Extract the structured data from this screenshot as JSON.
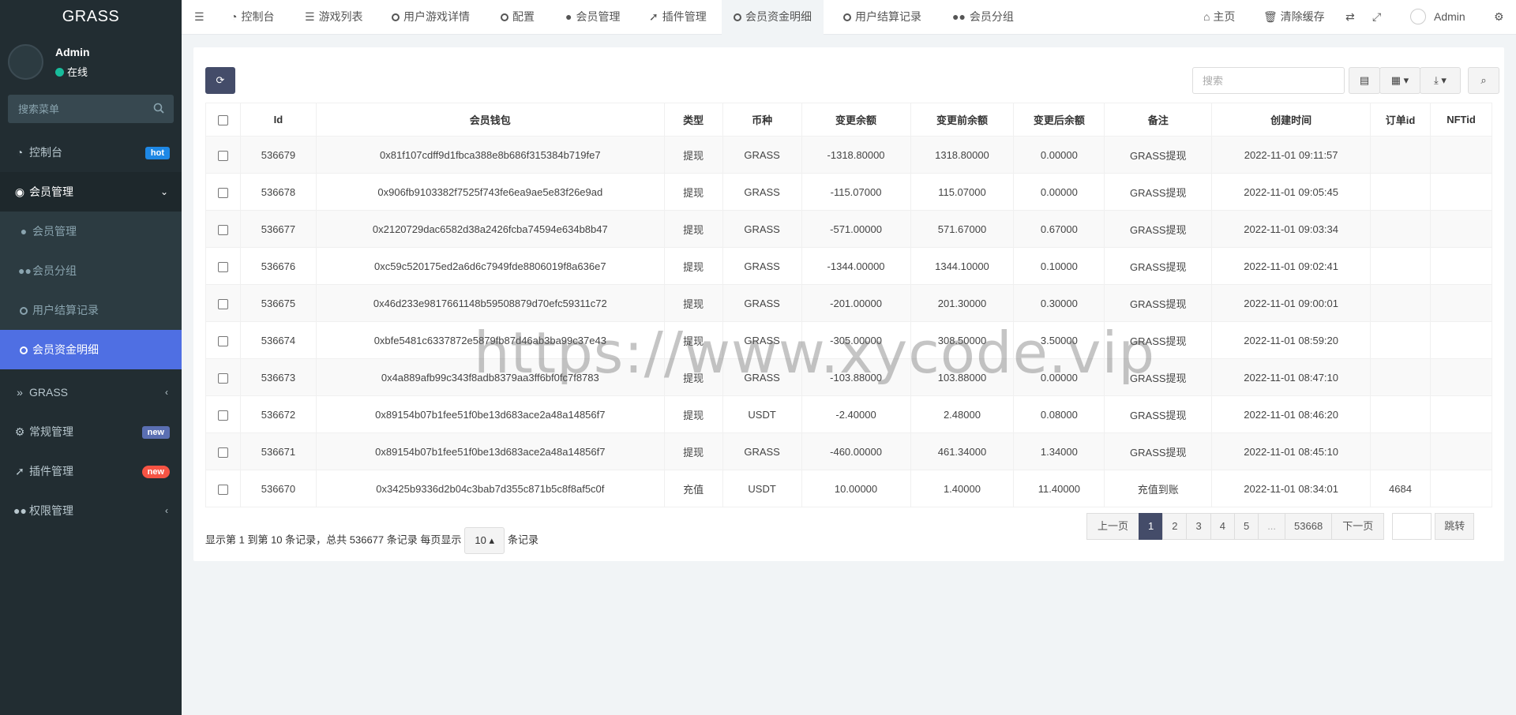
{
  "app": {
    "logo": "GRASS"
  },
  "user": {
    "name": "Admin",
    "status": "在线"
  },
  "sidebar": {
    "search_placeholder": "搜索菜单",
    "items": [
      {
        "label": "控制台",
        "icon": "dashboard-icon",
        "badge": "hot"
      },
      {
        "label": "会员管理",
        "icon": "user-circle-icon"
      },
      {
        "label": "GRASS",
        "icon": "double-chevron-icon"
      },
      {
        "label": "常规管理",
        "icon": "cogs-icon",
        "badge": "new"
      },
      {
        "label": "插件管理",
        "icon": "rocket-icon",
        "badge": "new"
      },
      {
        "label": "权限管理",
        "icon": "group-icon"
      }
    ],
    "submenu": [
      {
        "label": "会员管理",
        "icon": "user-icon"
      },
      {
        "label": "会员分组",
        "icon": "users-icon"
      },
      {
        "label": "用户结算记录",
        "icon": "circle-icon"
      },
      {
        "label": "会员资金明细",
        "icon": "circle-icon"
      }
    ]
  },
  "topnav": {
    "tabs": [
      {
        "label": "控制台"
      },
      {
        "label": "游戏列表"
      },
      {
        "label": "用户游戏详情"
      },
      {
        "label": "配置"
      },
      {
        "label": "会员管理"
      },
      {
        "label": "插件管理"
      },
      {
        "label": "会员资金明细"
      },
      {
        "label": "用户结算记录"
      },
      {
        "label": "会员分组"
      }
    ],
    "home": "主页",
    "clear_cache": "清除缓存",
    "admin": "Admin"
  },
  "toolbar": {
    "search_placeholder": "搜索"
  },
  "table": {
    "headers": [
      "Id",
      "会员钱包",
      "类型",
      "币种",
      "变更余额",
      "变更前余额",
      "变更后余额",
      "备注",
      "创建时间",
      "订单id",
      "NFTid"
    ],
    "rows": [
      [
        "536679",
        "0x81f107cdff9d1fbca388e8b686f315384b719fe7",
        "提现",
        "GRASS",
        "-1318.80000",
        "1318.80000",
        "0.00000",
        "GRASS提现",
        "2022-11-01 09:11:57",
        "",
        ""
      ],
      [
        "536678",
        "0x906fb9103382f7525f743fe6ea9ae5e83f26e9ad",
        "提现",
        "GRASS",
        "-115.07000",
        "115.07000",
        "0.00000",
        "GRASS提现",
        "2022-11-01 09:05:45",
        "",
        ""
      ],
      [
        "536677",
        "0x2120729dac6582d38a2426fcba74594e634b8b47",
        "提现",
        "GRASS",
        "-571.00000",
        "571.67000",
        "0.67000",
        "GRASS提现",
        "2022-11-01 09:03:34",
        "",
        ""
      ],
      [
        "536676",
        "0xc59c520175ed2a6d6c7949fde8806019f8a636e7",
        "提现",
        "GRASS",
        "-1344.00000",
        "1344.10000",
        "0.10000",
        "GRASS提现",
        "2022-11-01 09:02:41",
        "",
        ""
      ],
      [
        "536675",
        "0x46d233e9817661148b59508879d70efc59311c72",
        "提现",
        "GRASS",
        "-201.00000",
        "201.30000",
        "0.30000",
        "GRASS提现",
        "2022-11-01 09:00:01",
        "",
        ""
      ],
      [
        "536674",
        "0xbfe5481c6337872e5879fb87d46ab3ba99c37e43",
        "提现",
        "GRASS",
        "-305.00000",
        "308.50000",
        "3.50000",
        "GRASS提现",
        "2022-11-01 08:59:20",
        "",
        ""
      ],
      [
        "536673",
        "0x4a889afb99c343f8adb8379aa3ff6bf0fc7f8783",
        "提现",
        "GRASS",
        "-103.88000",
        "103.88000",
        "0.00000",
        "GRASS提现",
        "2022-11-01 08:47:10",
        "",
        ""
      ],
      [
        "536672",
        "0x89154b07b1fee51f0be13d683ace2a48a14856f7",
        "提现",
        "USDT",
        "-2.40000",
        "2.48000",
        "0.08000",
        "GRASS提现",
        "2022-11-01 08:46:20",
        "",
        ""
      ],
      [
        "536671",
        "0x89154b07b1fee51f0be13d683ace2a48a14856f7",
        "提现",
        "GRASS",
        "-460.00000",
        "461.34000",
        "1.34000",
        "GRASS提现",
        "2022-11-01 08:45:10",
        "",
        ""
      ],
      [
        "536670",
        "0x3425b9336d2b04c3bab7d355c871b5c8f8af5c0f",
        "充值",
        "USDT",
        "10.00000",
        "1.40000",
        "11.40000",
        "充值到账",
        "2022-11-01 08:34:01",
        "4684",
        ""
      ]
    ]
  },
  "footer": {
    "info_prefix": "显示第 1 到第 10 条记录，总共 536677 条记录 每页显示",
    "page_size": "10",
    "info_suffix": "条记录"
  },
  "pagination": {
    "prev": "上一页",
    "pages": [
      "1",
      "2",
      "3",
      "4",
      "5",
      "...",
      "53668"
    ],
    "next": "下一页",
    "jump": "跳转"
  },
  "watermark": "https://www.xycode.vip",
  "colors": {
    "sidebar_bg": "#222d32",
    "active_menu": "#4f6fe3",
    "accent_dark": "#444c69",
    "green_text": "#18bc9c"
  }
}
